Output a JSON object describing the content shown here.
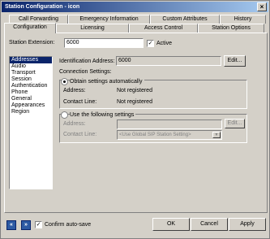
{
  "window": {
    "title": "Station Configuration - icon",
    "close_glyph": "×"
  },
  "tabs_row1": [
    {
      "label": "Call Forwarding"
    },
    {
      "label": "Emergency Information"
    },
    {
      "label": "Custom Attributes"
    },
    {
      "label": "History"
    }
  ],
  "tabs_row2": [
    {
      "label": "Configuration"
    },
    {
      "label": "Licensing"
    },
    {
      "label": "Access Control"
    },
    {
      "label": "Station Options"
    }
  ],
  "station": {
    "extension_label": "Station Extension:",
    "extension_value": "6000",
    "active_label": "Active",
    "active_checked": "✓"
  },
  "sidebar": {
    "items": [
      {
        "label": "Addresses"
      },
      {
        "label": "Audio"
      },
      {
        "label": "Transport"
      },
      {
        "label": "Session"
      },
      {
        "label": "Authentication"
      },
      {
        "label": "Phone"
      },
      {
        "label": "General"
      },
      {
        "label": "Appearances"
      },
      {
        "label": "Region"
      }
    ]
  },
  "main": {
    "identification_label": "Identification Address:",
    "identification_value": "6000",
    "edit_label": "Edit...",
    "connection_settings_label": "Connection Settings:",
    "obtain_auto_label": "Obtain settings automatically",
    "address_label": "Address:",
    "address_value": "Not registered",
    "contact_line_label": "Contact Line:",
    "contact_line_value": "Not registered",
    "use_following_label": "Use the following settings",
    "address2_label": "Address:",
    "edit2_label": "Edit...",
    "contact_line2_label": "Contact Line:",
    "contact_line2_value": "<Use Global SIP Station Setting>",
    "dropdown_arrow": "▼"
  },
  "footer": {
    "prev_glyph": "«",
    "next_glyph": "»",
    "confirm_label": "Confirm auto-save",
    "confirm_checked": "✓",
    "ok_label": "OK",
    "cancel_label": "Cancel",
    "apply_label": "Apply"
  }
}
